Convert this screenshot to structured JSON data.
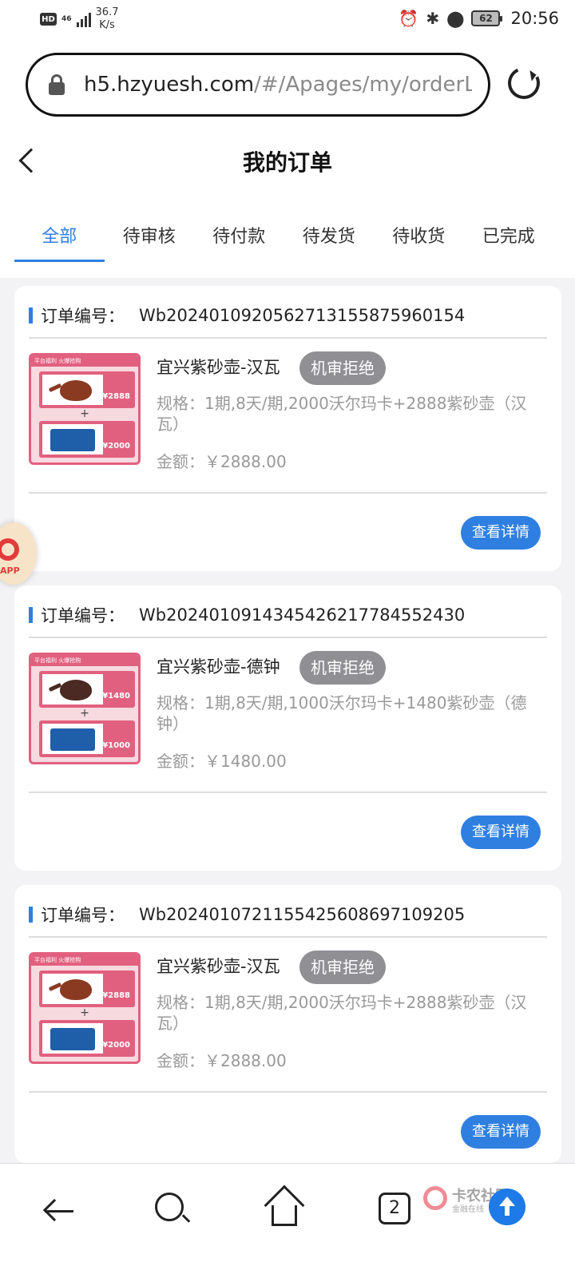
{
  "status_bar": {
    "hd": "HD",
    "network": "46",
    "speed_value": "36.7",
    "speed_unit": "K/s",
    "battery": "62",
    "time": "20:56"
  },
  "browser": {
    "url_host": "h5.hzyuesh.com",
    "url_path": "/#/Apages/my/orderList"
  },
  "header": {
    "title": "我的订单"
  },
  "tabs": [
    {
      "label": "全部",
      "active": true
    },
    {
      "label": "待审核",
      "active": false
    },
    {
      "label": "待付款",
      "active": false
    },
    {
      "label": "待发货",
      "active": false
    },
    {
      "label": "待收货",
      "active": false
    },
    {
      "label": "已完成",
      "active": false
    }
  ],
  "orders": [
    {
      "order_label": "订单编号：",
      "order_no": "Wb2024010920562713155875960154",
      "product": "宜兴紫砂壶-汉瓦",
      "status": "机审拒绝",
      "spec": "规格：1期,8天/期,2000沃尔玛卡+2888紫砂壶（汉瓦）",
      "amount": "金额：￥2888.00",
      "thumb_top_price": "¥2888",
      "thumb_bottom_price": "¥2000",
      "detail_label": "查看详情"
    },
    {
      "order_label": "订单编号：",
      "order_no": "Wb2024010914345426217784552430",
      "product": "宜兴紫砂壶-德钟",
      "status": "机审拒绝",
      "spec": "规格：1期,8天/期,1000沃尔玛卡+1480紫砂壶（德钟）",
      "amount": "金额：￥1480.00",
      "thumb_top_price": "¥1480",
      "thumb_bottom_price": "¥1000",
      "detail_label": "查看详情"
    },
    {
      "order_label": "订单编号：",
      "order_no": "Wb2024010721155425608697109205",
      "product": "宜兴紫砂壶-汉瓦",
      "status": "机审拒绝",
      "spec": "规格：1期,8天/期,2000沃尔玛卡+2888紫砂壶（汉瓦）",
      "amount": "金额：￥2888.00",
      "thumb_top_price": "¥2888",
      "thumb_bottom_price": "¥2000",
      "detail_label": "查看详情"
    }
  ],
  "thumb_banner": "平台福利 火爆抢购",
  "float_app_label": "APP",
  "bottom_nav": {
    "tab_count": "2",
    "watermark_title": "卡农社区",
    "watermark_sub": "金融在线"
  },
  "colors": {
    "accent": "#2f7fe0",
    "badge_gray": "#8f8f94",
    "thumb_pink": "#e2607f"
  },
  "icons": [
    "lock-icon",
    "reload-icon",
    "back-icon",
    "search-icon",
    "home-icon",
    "tabs-icon",
    "scroll-top-icon",
    "app-float-icon"
  ]
}
